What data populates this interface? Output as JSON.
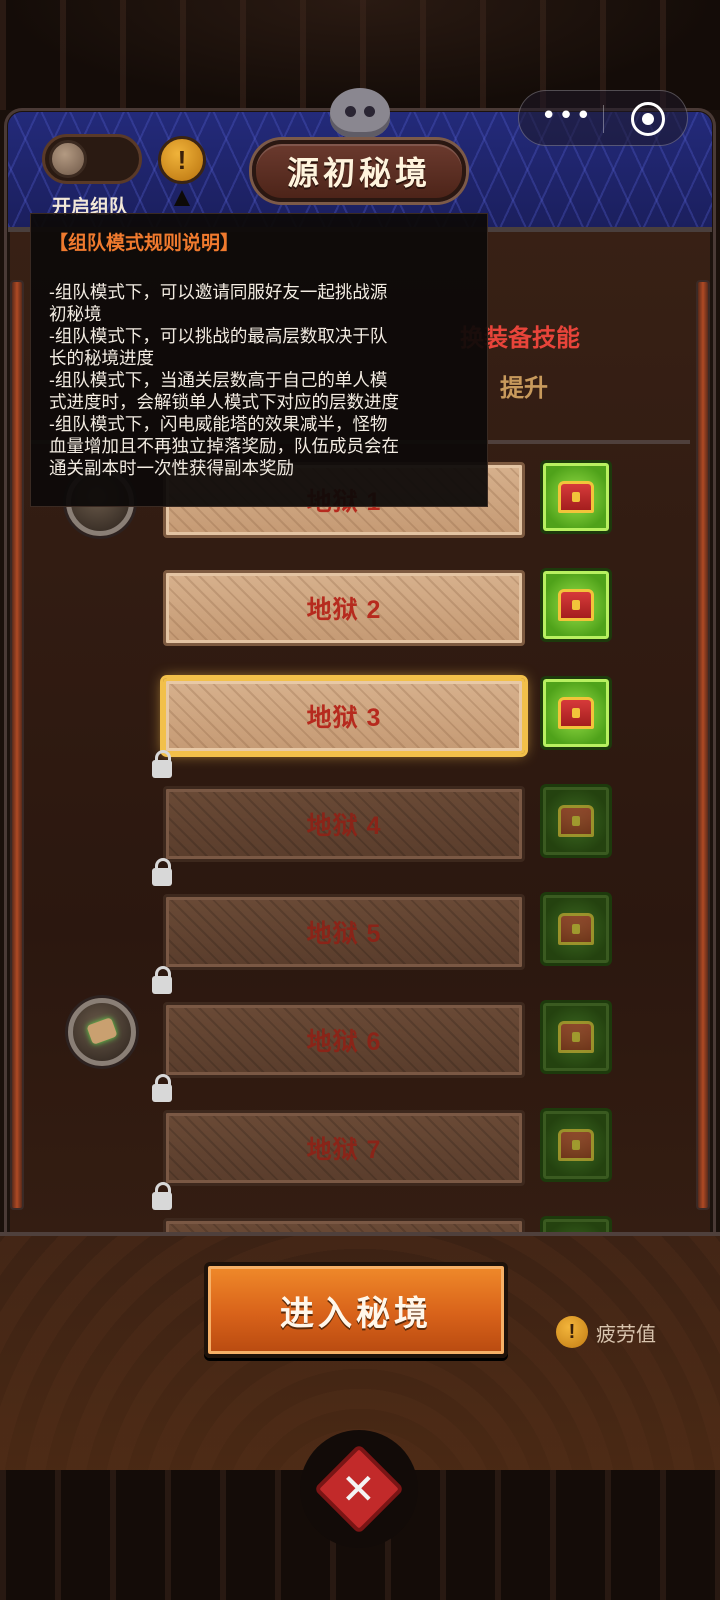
{
  "header": {
    "title": "源初秘境",
    "team_toggle_label": "开启组队",
    "info_icon": "!"
  },
  "capsule": {
    "menu_icon": "•••"
  },
  "background_hints": {
    "equipment_hint": "换装备技能",
    "upgrade_hint": "提升"
  },
  "popup": {
    "title": "【组队模式规则说明】",
    "lines": [
      "-组队模式下，可以邀请同服好友一起挑战源",
      "初秘境",
      "-组队模式下，可以挑战的最高层数取决于队",
      "长的秘境进度",
      "-组队模式下，当通关层数高于自己的单人模",
      "式进度时，会解锁单人模式下对应的层数进度",
      "-组队模式下，闪电威能塔的效果减半，怪物",
      "血量增加且不再独立掉落奖励，队伍成员会在",
      "通关副本时一次性获得副本奖励"
    ]
  },
  "floors": [
    {
      "label": "地狱 1",
      "state": "unlocked"
    },
    {
      "label": "地狱 2",
      "state": "unlocked"
    },
    {
      "label": "地狱 3",
      "state": "selected"
    },
    {
      "label": "地狱 4",
      "state": "locked"
    },
    {
      "label": "地狱 5",
      "state": "locked"
    },
    {
      "label": "地狱 6",
      "state": "locked"
    },
    {
      "label": "地狱 7",
      "state": "locked"
    }
  ],
  "footer": {
    "enter_label": "进入秘境",
    "fatigue_label": "疲劳值",
    "fatigue_icon": "!",
    "battle_icon": "✕"
  },
  "colors": {
    "header_blue": "#232a7a",
    "floor_text_red": "#b62a1e",
    "popup_title_orange": "#f07a2e",
    "selected_gold": "#f2c04a",
    "chest_green": "#4fa21a",
    "enter_button_orange": "#d8621a"
  }
}
